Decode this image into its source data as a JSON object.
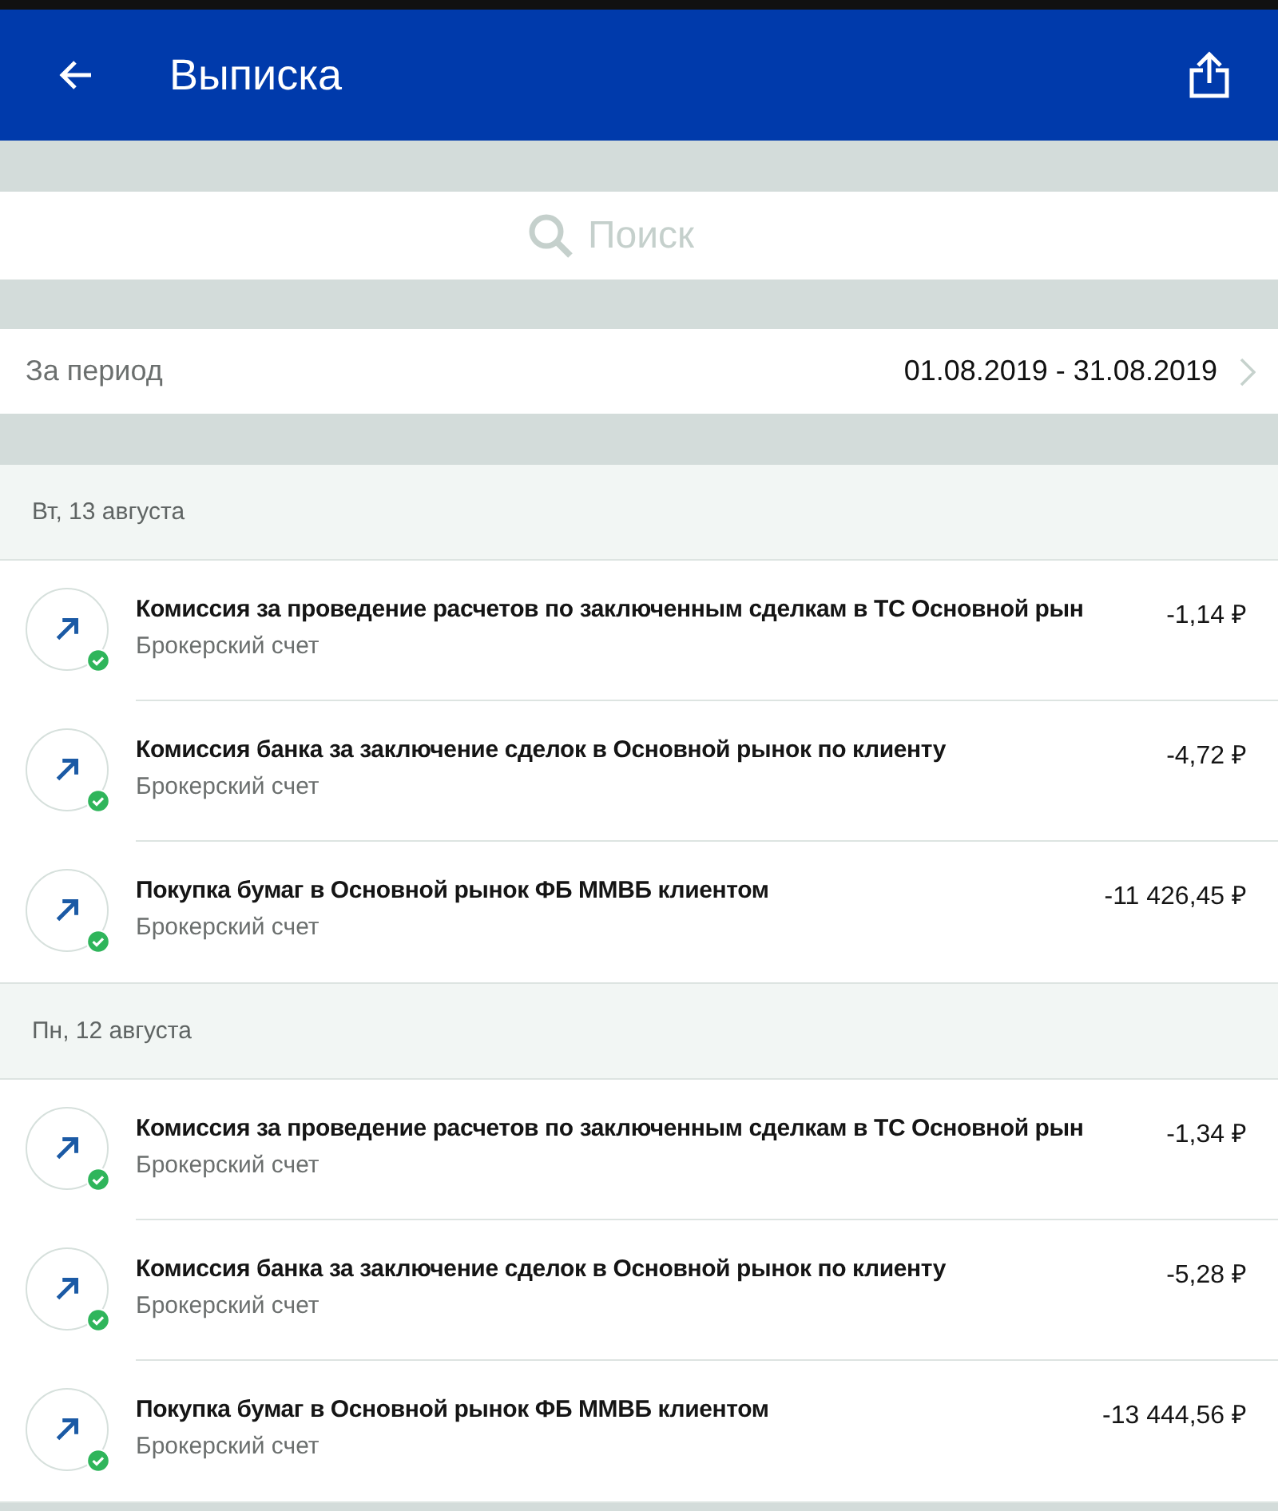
{
  "header": {
    "title": "Выписка"
  },
  "search": {
    "placeholder": "Поиск"
  },
  "period": {
    "label": "За период",
    "value": "01.08.2019 - 31.08.2019"
  },
  "days": [
    {
      "date": "Вт, 13 августа",
      "transactions": [
        {
          "title": "Комиссия за проведение расчетов по заключенным сделкам в ТС Основной рын",
          "account": "Брокерский счет",
          "amount": "-1,14 ₽",
          "completed": true
        },
        {
          "title": "Комиссия банка за заключение сделок в Основной рынок по клиенту",
          "account": "Брокерский счет",
          "amount": "-4,72 ₽",
          "completed": true
        },
        {
          "title": "Покупка бумаг в Основной рынок ФБ ММВБ клиентом",
          "account": "Брокерский счет",
          "amount": "-11 426,45 ₽",
          "completed": true
        }
      ]
    },
    {
      "date": "Пн, 12 августа",
      "transactions": [
        {
          "title": "Комиссия за проведение расчетов по заключенным сделкам в ТС Основной рын",
          "account": "Брокерский счет",
          "amount": "-1,34 ₽",
          "completed": true
        },
        {
          "title": "Комиссия банка за заключение сделок в Основной рынок по клиенту",
          "account": "Брокерский счет",
          "amount": "-5,28 ₽",
          "completed": true
        },
        {
          "title": "Покупка бумаг в Основной рынок ФБ ММВБ клиентом",
          "account": "Брокерский счет",
          "amount": "-13 444,56 ₽",
          "completed": true
        }
      ]
    }
  ]
}
